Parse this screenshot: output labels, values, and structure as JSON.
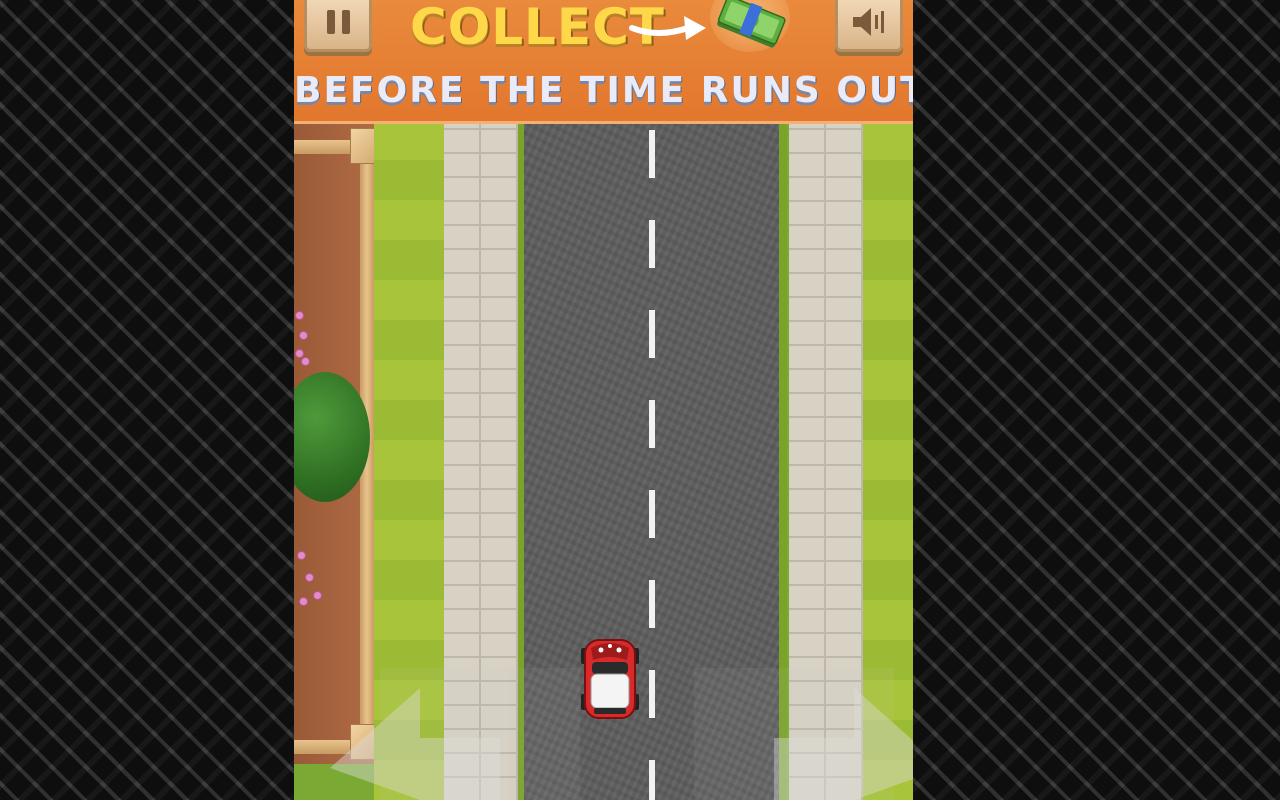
{
  "banner": {
    "title": "COLLECT",
    "subtitle": "BEFORE THE TIME RUNS OUT!",
    "pause_icon": "pause-icon",
    "sound_icon": "speaker-icon",
    "pickup_icon": "money-stack-icon"
  },
  "controls": {
    "left_icon": "arrow-left-icon",
    "right_icon": "arrow-right-icon"
  },
  "player_car": "red-white-car",
  "colors": {
    "banner": "#e2772d",
    "title": "#ffd84a",
    "subtitle": "#e9ecf8",
    "road": "#5f5f5f",
    "grass": "#a7c43a"
  }
}
